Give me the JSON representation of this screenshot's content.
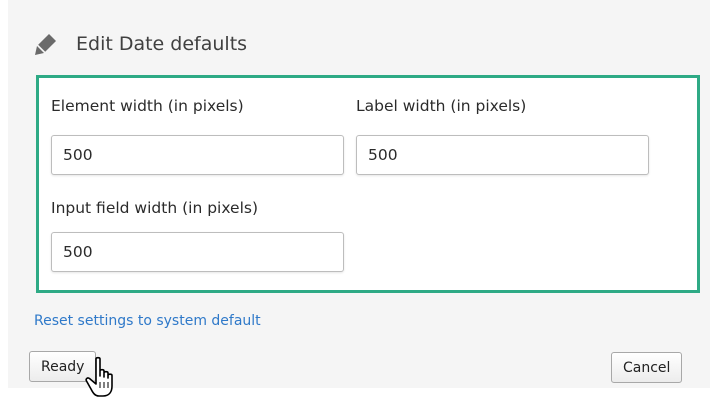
{
  "dialog": {
    "title": "Edit Date defaults",
    "icon": "pencil-icon"
  },
  "fields": {
    "element_width": {
      "label": "Element width (in pixels)",
      "value": "500"
    },
    "label_width": {
      "label": "Label width (in pixels)",
      "value": "500"
    },
    "input_field_width": {
      "label": "Input field width (in pixels)",
      "value": "500"
    }
  },
  "reset_link": "Reset settings to system default",
  "buttons": {
    "ready": "Ready",
    "cancel": "Cancel"
  },
  "colors": {
    "highlight_border": "#2eaa85",
    "link": "#2f79c9"
  }
}
